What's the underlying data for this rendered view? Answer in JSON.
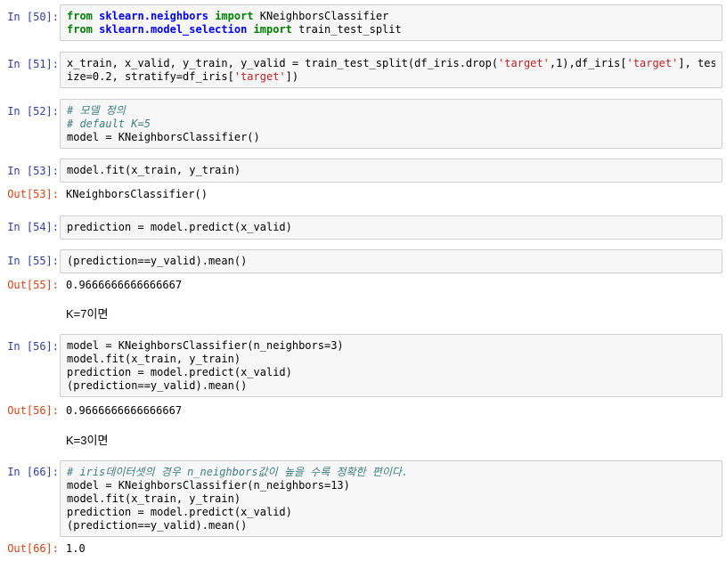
{
  "cells": [
    {
      "prompt": "In [50]:",
      "line1": {
        "k1": "from",
        "m1": "sklearn.neighbors",
        "k2": "import",
        "r": "KNeighborsClassifier"
      },
      "line2": {
        "k1": "from",
        "m1": "sklearn.model_selection",
        "k2": "import",
        "r": "train_test_split"
      }
    },
    {
      "prompt": "In [51]:",
      "a": "x_train, x_valid, y_train, y_valid = train_test_split(df_iris.drop(",
      "s1": "'target'",
      "b": ",1),df_iris[",
      "s2": "'target'",
      "c": "], test_s",
      "d": "ize=0.2, stratify=df_iris[",
      "s3": "'target'",
      "e": "])"
    },
    {
      "prompt": "In [52]:",
      "c1": "# 모델 정의",
      "c2": "# default K=5",
      "l3": "model = KNeighborsClassifier()"
    },
    {
      "prompt": "In [53]:",
      "l1": "model.fit(x_train, y_train)",
      "out_prompt": "Out[53]:",
      "out": "KNeighborsClassifier()"
    },
    {
      "prompt": "In [54]:",
      "l1": "prediction = model.predict(x_valid)"
    },
    {
      "prompt": "In [55]:",
      "l1": "(prediction==y_valid).mean()",
      "out_prompt": "Out[55]:",
      "out": "0.9666666666666667"
    },
    {
      "md": "K=7이면"
    },
    {
      "prompt": "In [56]:",
      "l1": "model = KNeighborsClassifier(n_neighbors=3)",
      "l2": "model.fit(x_train, y_train)",
      "l3": "prediction = model.predict(x_valid)",
      "l4": "(prediction==y_valid).mean()",
      "out_prompt": "Out[56]:",
      "out": "0.9666666666666667"
    },
    {
      "md": "K=3이면"
    },
    {
      "prompt": "In [66]:",
      "c1": "# iris데이터셋의 경우 n_neighbors값이 높을 수록 정확한 편이다.",
      "l2": "model = KNeighborsClassifier(n_neighbors=13)",
      "l3": "model.fit(x_train, y_train)",
      "l4": "prediction = model.predict(x_valid)",
      "l5": "(prediction==y_valid).mean()",
      "out_prompt": "Out[66]:",
      "out": "1.0"
    }
  ]
}
